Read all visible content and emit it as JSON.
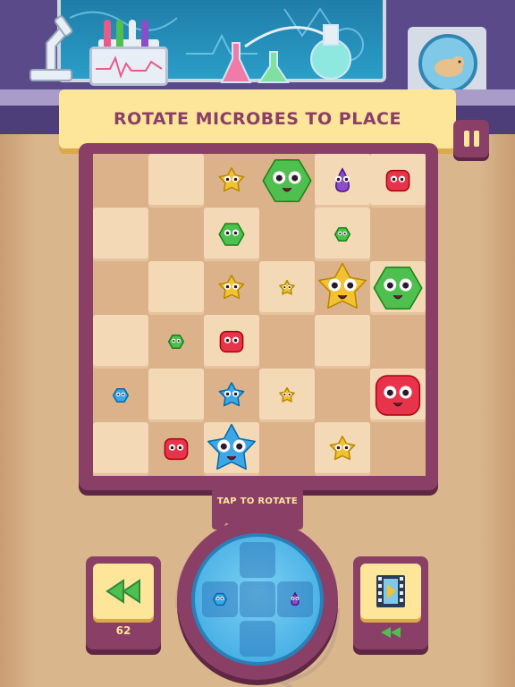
{
  "banner": {
    "title": "ROTATE MICROBES TO PLACE"
  },
  "controls": {
    "rotate_hint": "TAP TO ROTATE",
    "rewind_count": "62"
  },
  "colors": {
    "board": "#8a3f66",
    "banner": "#fde59a",
    "green": "#4fbf4f",
    "yellow": "#f2c232",
    "red": "#e8344a",
    "blue": "#3ca6e6",
    "purple": "#8a4fc8"
  },
  "board": {
    "columns": 6,
    "rows": 6,
    "light_cells": [
      [
        1,
        0
      ],
      [
        4,
        0
      ],
      [
        5,
        0
      ],
      [
        0,
        1
      ],
      [
        2,
        1
      ],
      [
        4,
        1
      ],
      [
        1,
        2
      ],
      [
        3,
        2
      ],
      [
        5,
        2
      ],
      [
        0,
        3
      ],
      [
        2,
        3
      ],
      [
        4,
        3
      ],
      [
        1,
        4
      ],
      [
        3,
        4
      ],
      [
        5,
        4
      ],
      [
        0,
        5
      ],
      [
        2,
        5
      ],
      [
        4,
        5
      ]
    ],
    "microbes": [
      {
        "name": "microbe-yellow-star",
        "shape": "star",
        "color": "yellow",
        "col": 2,
        "row": 0,
        "size": "small"
      },
      {
        "name": "microbe-green-blob",
        "shape": "blob",
        "color": "green",
        "col": 3,
        "row": 0,
        "size": "large"
      },
      {
        "name": "microbe-purple-triangle",
        "shape": "triangle",
        "color": "purple",
        "col": 4,
        "row": 0,
        "size": "small"
      },
      {
        "name": "microbe-red-square",
        "shape": "square",
        "color": "red",
        "col": 5,
        "row": 0,
        "size": "small"
      },
      {
        "name": "microbe-green-blob",
        "shape": "blob",
        "color": "green",
        "col": 2,
        "row": 1,
        "size": "small"
      },
      {
        "name": "microbe-green-blob",
        "shape": "blob",
        "color": "green",
        "col": 4,
        "row": 1,
        "size": "tiny"
      },
      {
        "name": "microbe-yellow-star",
        "shape": "star",
        "color": "yellow",
        "col": 2,
        "row": 2,
        "size": "small"
      },
      {
        "name": "microbe-yellow-star",
        "shape": "star",
        "color": "yellow",
        "col": 3,
        "row": 2,
        "size": "tiny"
      },
      {
        "name": "microbe-yellow-star",
        "shape": "star",
        "color": "yellow",
        "col": 4,
        "row": 2,
        "size": "large"
      },
      {
        "name": "microbe-green-blob",
        "shape": "blob",
        "color": "green",
        "col": 5,
        "row": 2,
        "size": "large"
      },
      {
        "name": "microbe-green-blob",
        "shape": "blob",
        "color": "green",
        "col": 1,
        "row": 3,
        "size": "tiny"
      },
      {
        "name": "microbe-red-square",
        "shape": "square",
        "color": "red",
        "col": 2,
        "row": 3,
        "size": "small"
      },
      {
        "name": "microbe-blue-blob",
        "shape": "blob",
        "color": "blue",
        "col": 0,
        "row": 4,
        "size": "tiny"
      },
      {
        "name": "microbe-blue-star",
        "shape": "star",
        "color": "blue",
        "col": 2,
        "row": 4,
        "size": "small"
      },
      {
        "name": "microbe-yellow-star",
        "shape": "star",
        "color": "yellow",
        "col": 3,
        "row": 4,
        "size": "tiny"
      },
      {
        "name": "microbe-red-square",
        "shape": "square",
        "color": "red",
        "col": 5,
        "row": 4,
        "size": "large"
      },
      {
        "name": "microbe-red-square",
        "shape": "square",
        "color": "red",
        "col": 1,
        "row": 5,
        "size": "small"
      },
      {
        "name": "microbe-blue-star",
        "shape": "star",
        "color": "blue",
        "col": 2,
        "row": 5,
        "size": "large"
      },
      {
        "name": "microbe-yellow-star",
        "shape": "star",
        "color": "yellow",
        "col": 4,
        "row": 5,
        "size": "small"
      }
    ]
  },
  "dial": {
    "microbes": [
      {
        "name": "dial-microbe-blue",
        "shape": "blob",
        "color": "blue",
        "slot": "left"
      },
      {
        "name": "dial-microbe-purple",
        "shape": "triangle",
        "color": "purple",
        "slot": "right"
      }
    ]
  },
  "icons": {
    "rewind": "rewind-icon",
    "video": "video-play-icon",
    "pause": "pause-icon"
  }
}
